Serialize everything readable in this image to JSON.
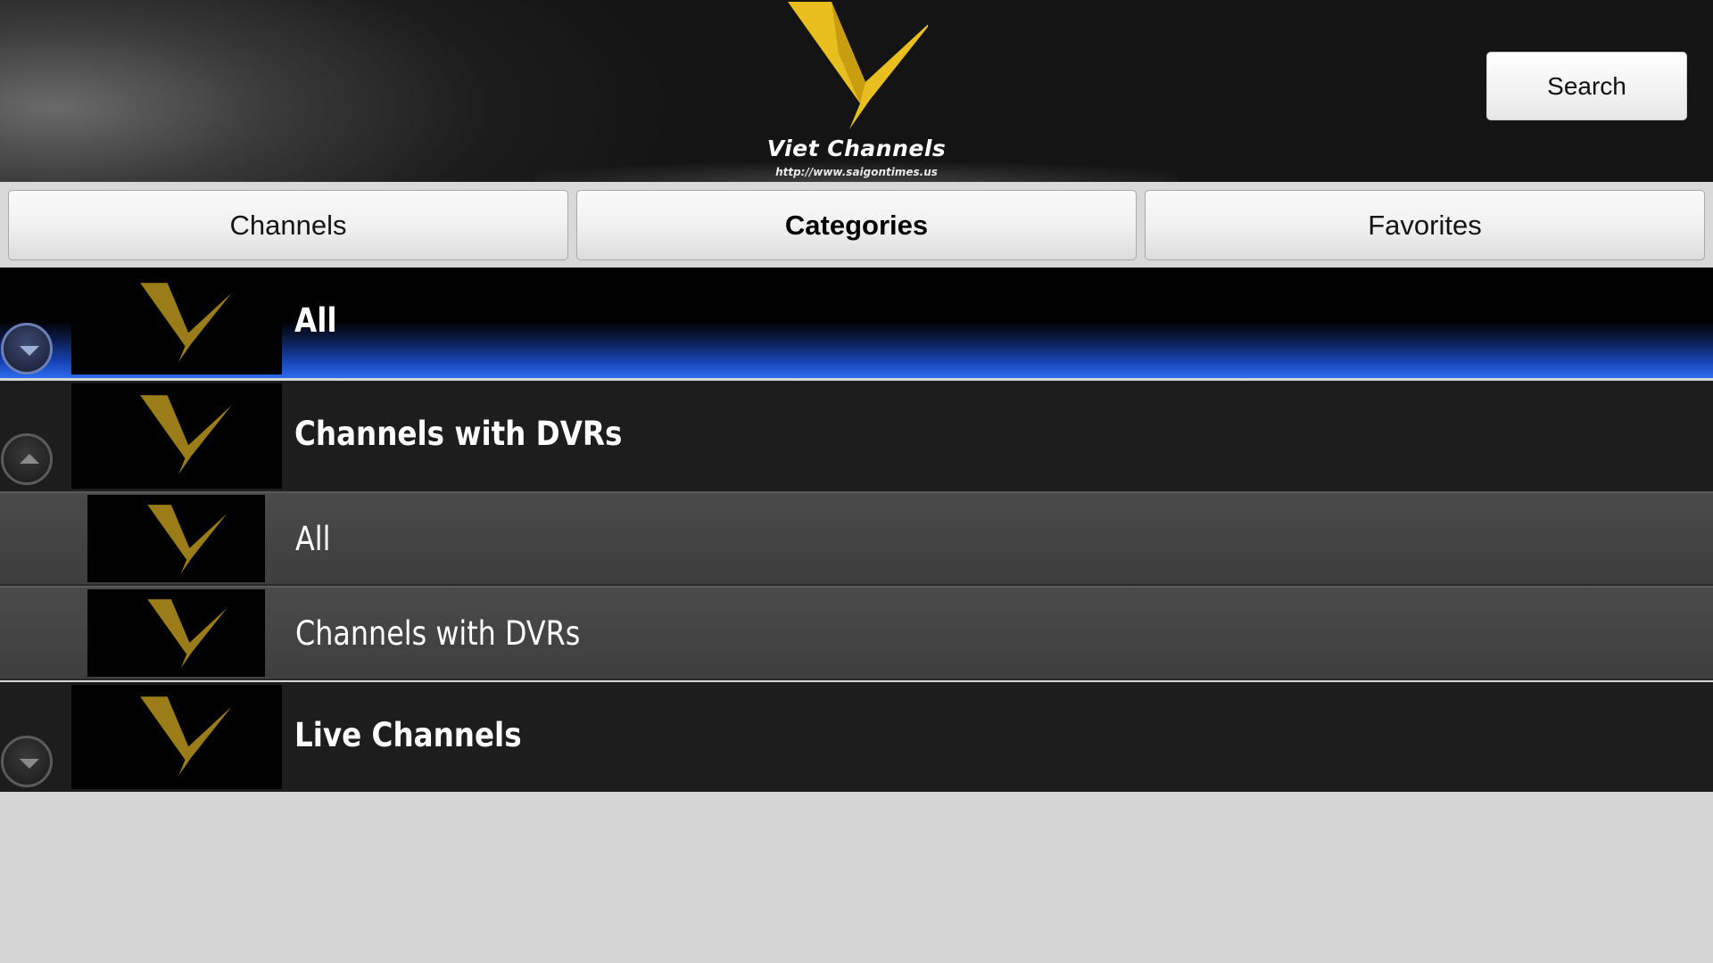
{
  "header": {
    "brand_name": "Viet Channels",
    "brand_url": "http://www.saigontimes.us",
    "search_label": "Search",
    "logo_color": "#e8bf1e"
  },
  "tabs": [
    {
      "label": "Channels",
      "active": false
    },
    {
      "label": "Categories",
      "active": true
    },
    {
      "label": "Favorites",
      "active": false
    }
  ],
  "categories": [
    {
      "label": "All",
      "level": "top",
      "state": "collapsed",
      "selected": true
    },
    {
      "label": "Channels with DVRs",
      "level": "top",
      "state": "expanded",
      "selected": false
    },
    {
      "label": "All",
      "level": "sub"
    },
    {
      "label": "Channels with DVRs",
      "level": "sub"
    },
    {
      "label": "Live Channels",
      "level": "top",
      "state": "collapsed",
      "selected": false
    }
  ],
  "colors": {
    "selection_blue": "#2d6cf0",
    "thumb_logo": "#9a7d18"
  }
}
